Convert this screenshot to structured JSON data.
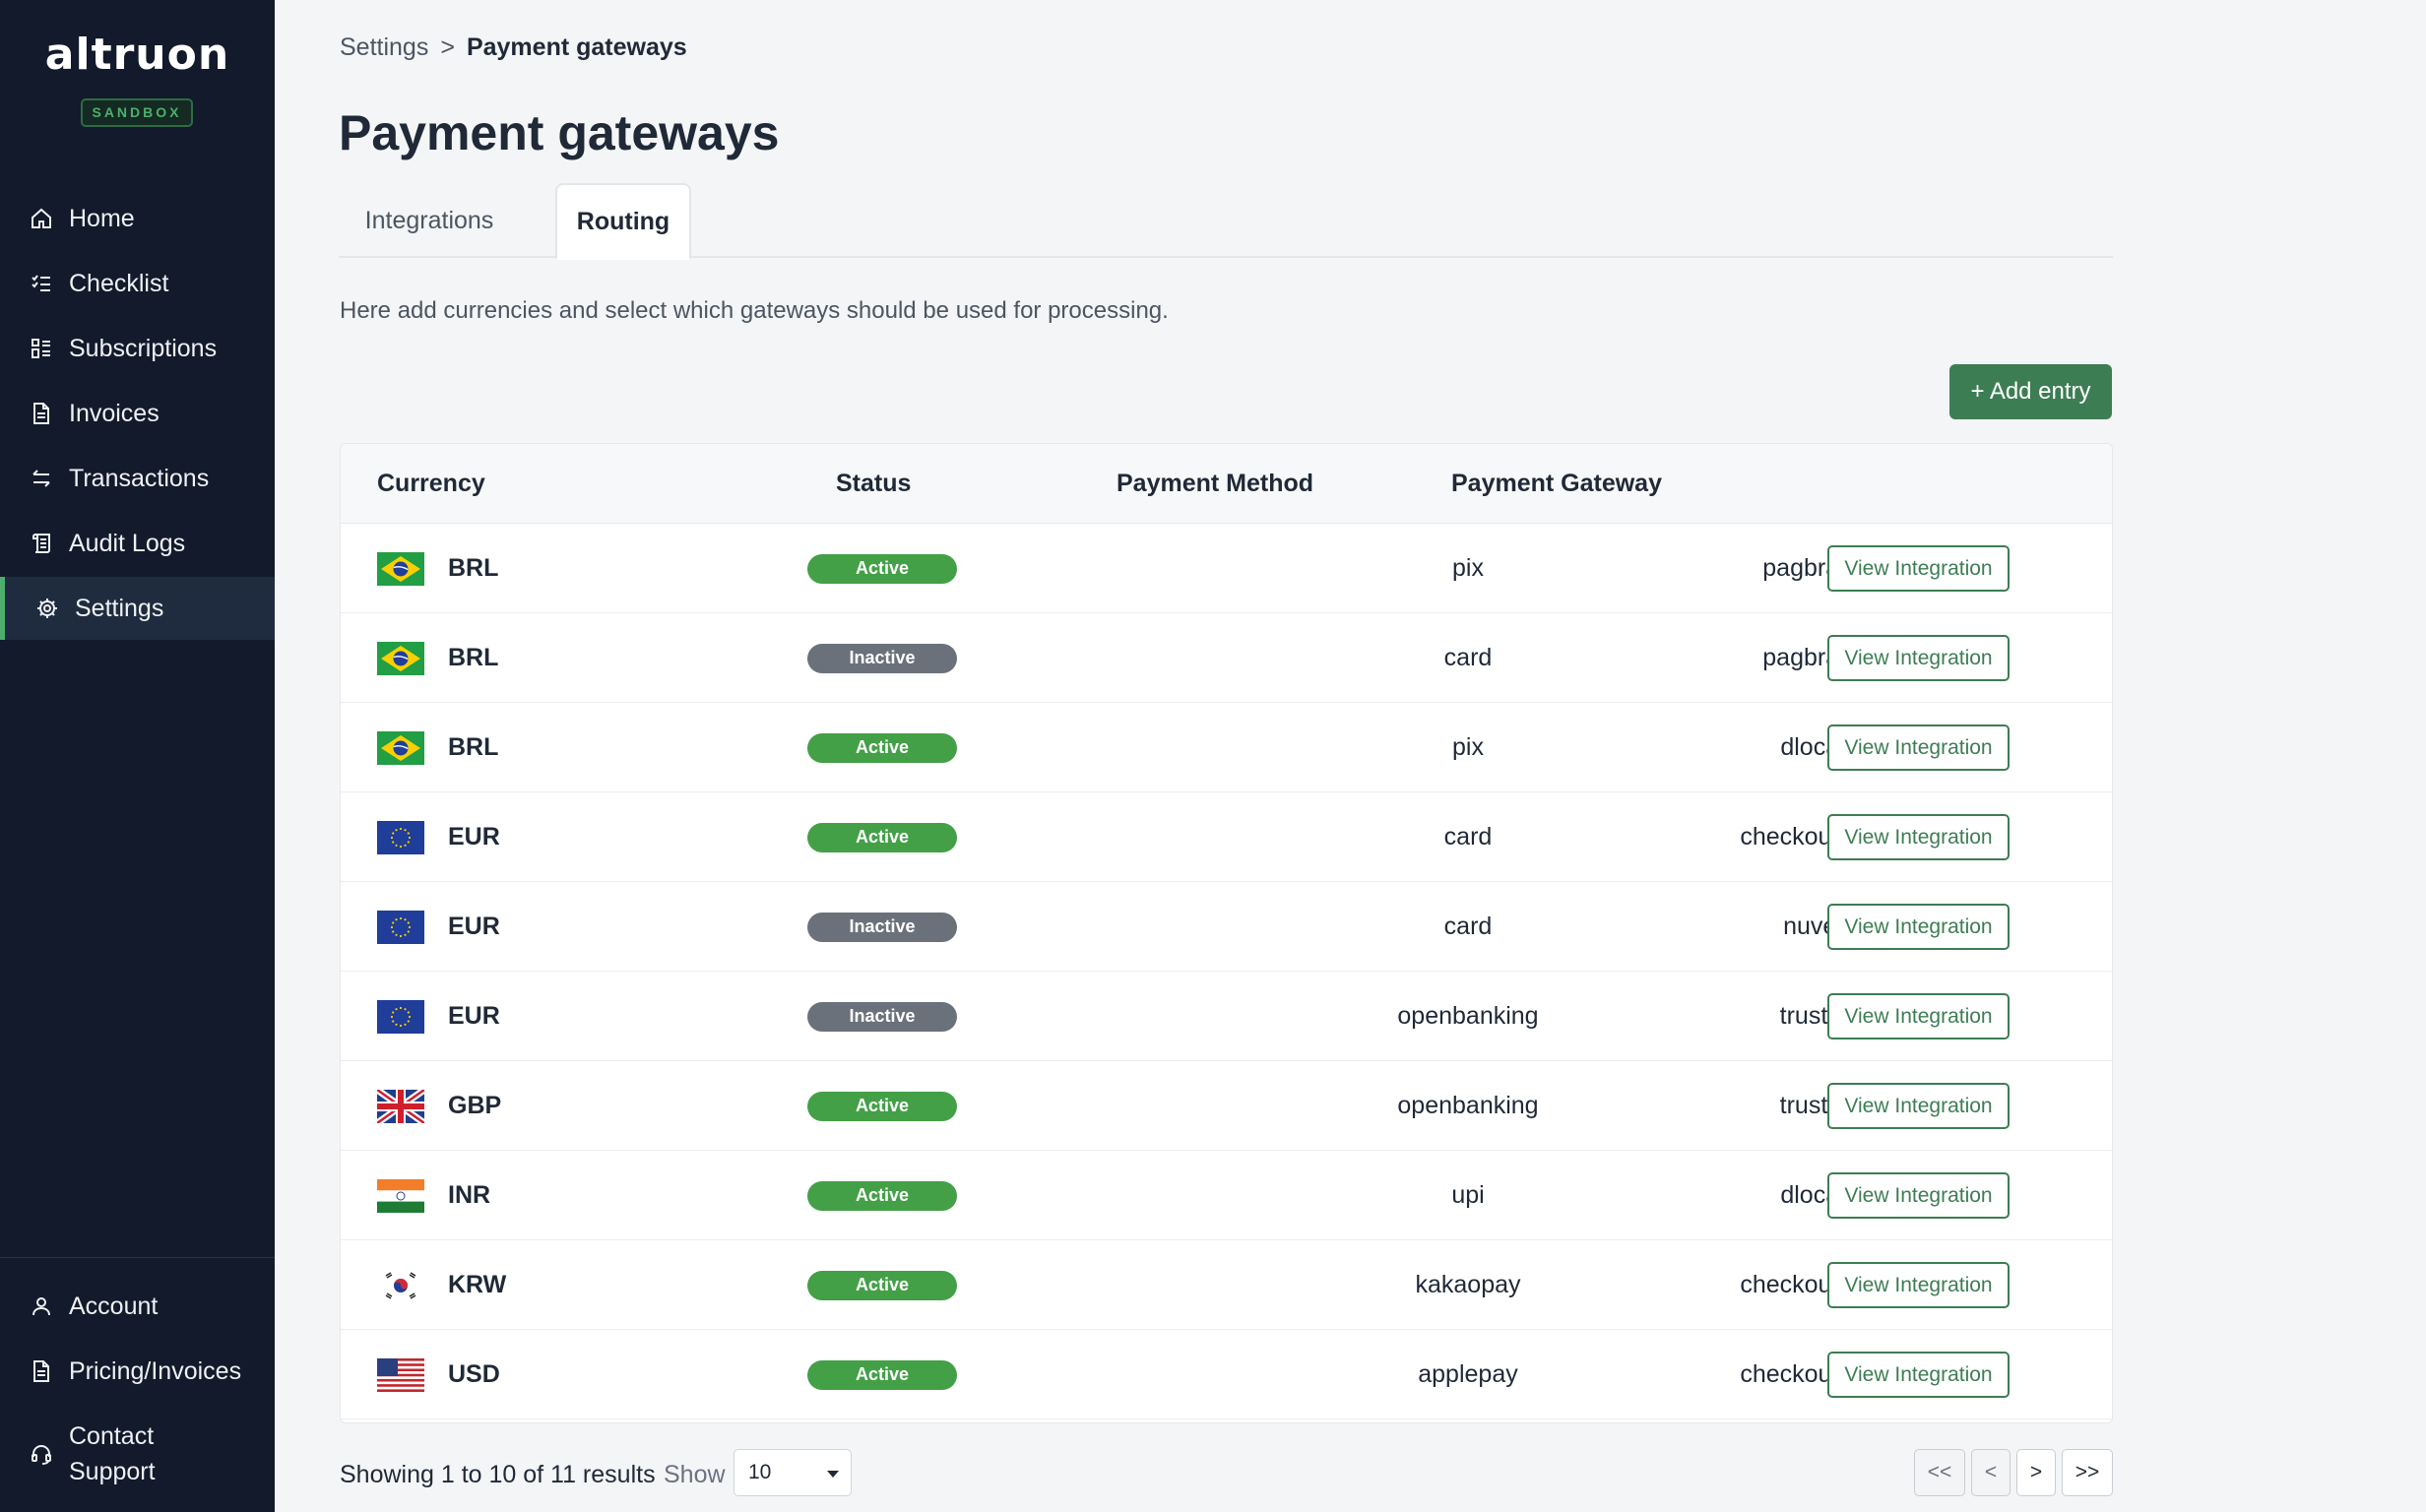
{
  "brand": {
    "name": "altruon",
    "env_badge": "SANDBOX"
  },
  "sidebar": {
    "items": [
      {
        "label": "Home",
        "icon": "home-icon"
      },
      {
        "label": "Checklist",
        "icon": "checklist-icon"
      },
      {
        "label": "Subscriptions",
        "icon": "subscriptions-icon"
      },
      {
        "label": "Invoices",
        "icon": "invoice-icon"
      },
      {
        "label": "Transactions",
        "icon": "transactions-icon"
      },
      {
        "label": "Audit Logs",
        "icon": "audit-log-icon"
      },
      {
        "label": "Settings",
        "icon": "gear-icon",
        "active": true
      }
    ],
    "bottom_items": [
      {
        "label": "Account",
        "icon": "user-icon"
      },
      {
        "label": "Pricing/Invoices",
        "icon": "invoice-icon"
      },
      {
        "label": "Contact Support",
        "icon": "headset-icon"
      }
    ]
  },
  "breadcrumb": {
    "parent": "Settings",
    "separator": ">",
    "current": "Payment gateways"
  },
  "page": {
    "title": "Payment gateways",
    "tabs": [
      {
        "label": "Integrations",
        "active": false
      },
      {
        "label": "Routing",
        "active": true
      }
    ],
    "description": "Here add currencies and select which gateways should be used for processing.",
    "add_button": "+ Add entry"
  },
  "table": {
    "headers": {
      "currency": "Currency",
      "status": "Status",
      "method": "Payment Method",
      "gateway": "Payment Gateway"
    },
    "rows": [
      {
        "flag": "brazil-flag",
        "currency": "BRL",
        "status": "Active",
        "method": "pix",
        "gateway": "pagbrasil",
        "action": "View Integration"
      },
      {
        "flag": "brazil-flag",
        "currency": "BRL",
        "status": "Inactive",
        "method": "card",
        "gateway": "pagbrasil",
        "action": "View Integration"
      },
      {
        "flag": "brazil-flag",
        "currency": "BRL",
        "status": "Active",
        "method": "pix",
        "gateway": "dlocal",
        "action": "View Integration"
      },
      {
        "flag": "eu-flag",
        "currency": "EUR",
        "status": "Active",
        "method": "card",
        "gateway": "checkoutcom",
        "action": "View Integration"
      },
      {
        "flag": "eu-flag",
        "currency": "EUR",
        "status": "Inactive",
        "method": "card",
        "gateway": "nuvei",
        "action": "View Integration"
      },
      {
        "flag": "eu-flag",
        "currency": "EUR",
        "status": "Inactive",
        "method": "openbanking",
        "gateway": "trustly",
        "action": "View Integration"
      },
      {
        "flag": "uk-flag",
        "currency": "GBP",
        "status": "Active",
        "method": "openbanking",
        "gateway": "trustly",
        "action": "View Integration"
      },
      {
        "flag": "india-flag",
        "currency": "INR",
        "status": "Active",
        "method": "upi",
        "gateway": "dlocal",
        "action": "View Integration"
      },
      {
        "flag": "korea-flag",
        "currency": "KRW",
        "status": "Active",
        "method": "kakaopay",
        "gateway": "checkoutcom",
        "action": "View Integration"
      },
      {
        "flag": "usa-flag",
        "currency": "USD",
        "status": "Active",
        "method": "applepay",
        "gateway": "checkoutcom",
        "action": "View Integration"
      }
    ]
  },
  "footer": {
    "showing": "Showing 1 to 10 of 11 results",
    "show_label": "Show",
    "page_size": "10",
    "pager": {
      "first": "<<",
      "prev": "<",
      "next": ">",
      "last": ">>"
    }
  },
  "colors": {
    "sidebar_bg": "#121a2b",
    "accent_green": "#3d7d54",
    "active_badge": "#43a047",
    "inactive_badge": "#6b717b"
  }
}
